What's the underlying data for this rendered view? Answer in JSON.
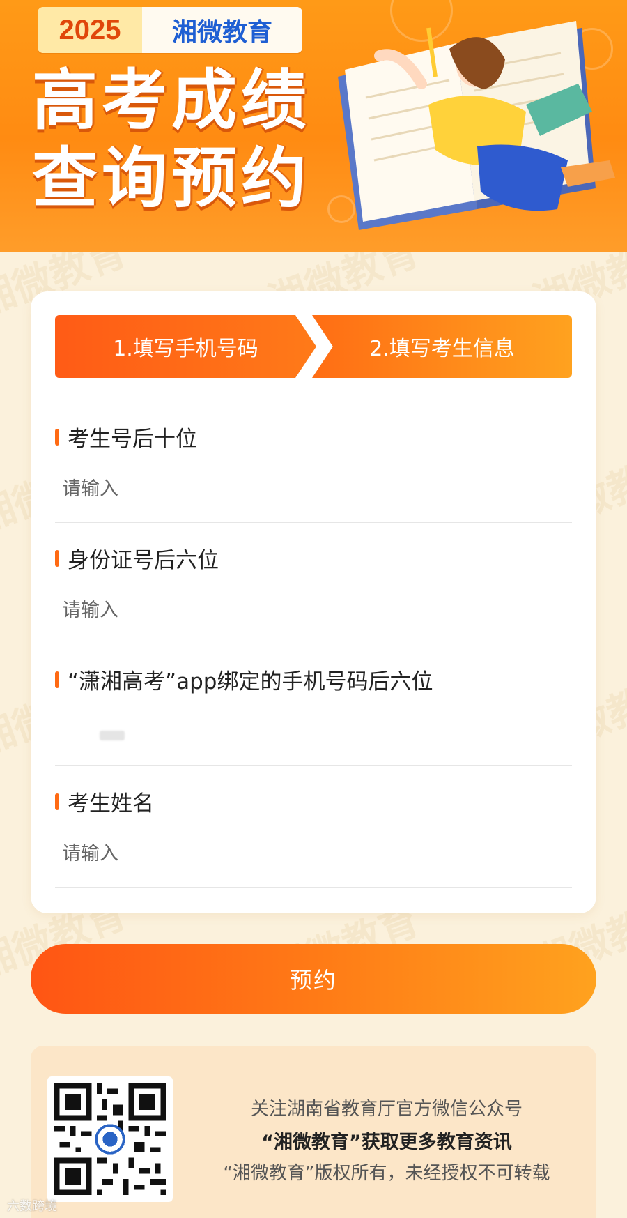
{
  "banner": {
    "year": "2025",
    "org": "湘微教育",
    "title_line1": "高考成绩",
    "title_line2": "查询预约"
  },
  "steps": [
    {
      "label": "1.填写手机号码"
    },
    {
      "label": "2.填写考生信息"
    }
  ],
  "form": {
    "fields": [
      {
        "label": "考生号后十位",
        "placeholder": "请输入",
        "value": ""
      },
      {
        "label": "身份证号后六位",
        "placeholder": "请输入",
        "value": ""
      },
      {
        "label": "“潇湘高考”app绑定的手机号码后六位",
        "placeholder": "",
        "value": ""
      },
      {
        "label": "考生姓名",
        "placeholder": "请输入",
        "value": ""
      }
    ]
  },
  "submit_label": "预约",
  "footer": {
    "line1": "关注湖南省教育厅官方微信公众号",
    "line2": "“湘微教育”获取更多教育资讯",
    "line3": "“湘微教育”版权所有，未经授权不可转载"
  },
  "watermark": "湘微教育",
  "corner_watermark": "六数跨境",
  "colors": {
    "accent": "#ff6a13",
    "banner": "#ff8b12",
    "page_bg": "#fbf1dc",
    "footer_bg": "#fce6c8",
    "org_blue": "#1f5fd3"
  },
  "icons": [
    "qr-code",
    "book-illustration",
    "student-illustration"
  ]
}
